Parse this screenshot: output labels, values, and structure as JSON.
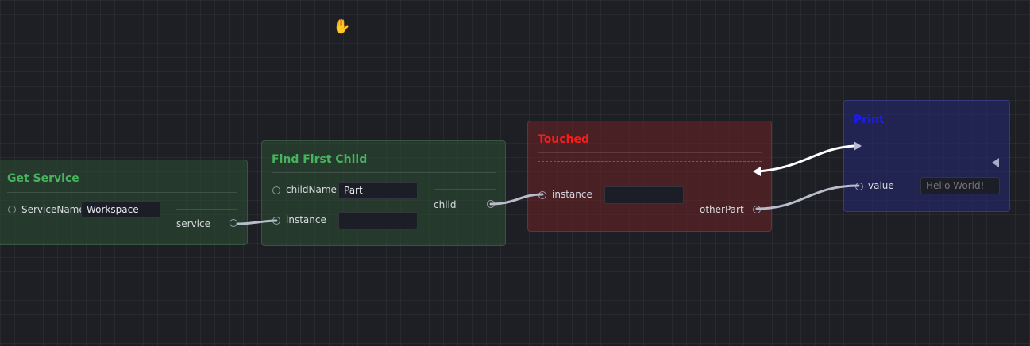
{
  "nodes": {
    "get_service": {
      "title": "Get Service",
      "input_label": "ServiceName",
      "input_value": "Workspace",
      "output_label": "service"
    },
    "find_first_child": {
      "title": "Find First Child",
      "input1_label": "childName",
      "input1_value": "Part",
      "input2_label": "instance",
      "input2_value": "",
      "output_label": "child"
    },
    "touched": {
      "title": "Touched",
      "input_label": "instance",
      "input_value": "",
      "output_label": "otherPart"
    },
    "print": {
      "title": "Print",
      "input_label": "value",
      "input_placeholder": "Hello World!"
    }
  },
  "colors": {
    "background": "#1d1f24",
    "green_title": "#47b35c",
    "red_title": "#ff1a1a",
    "blue_title": "#1a1aff",
    "wire": "#b9bcc9",
    "exec_wire": "#ffffff"
  },
  "cursor": {
    "icon": "hand-grab-icon",
    "glyph": "✋"
  }
}
